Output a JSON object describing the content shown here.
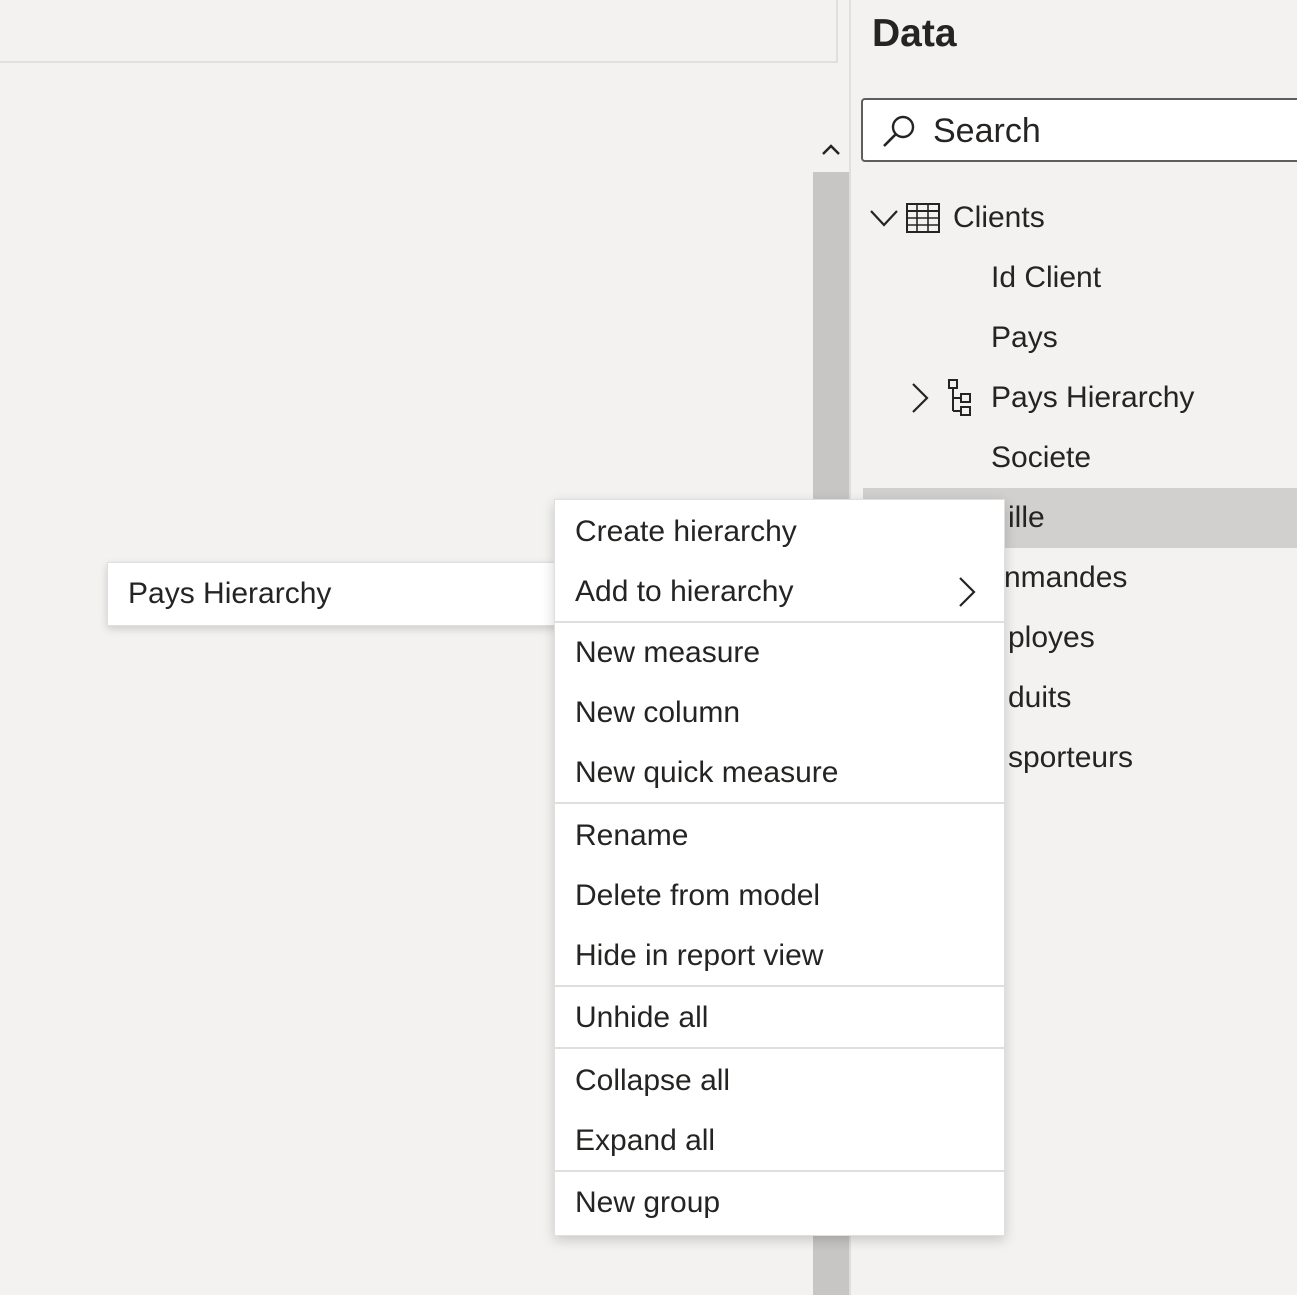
{
  "data_pane": {
    "title": "Data",
    "search_placeholder": "Search",
    "search_icon": "search-icon",
    "tree": {
      "table": {
        "label": "Clients",
        "icon": "table-icon",
        "expanded": true
      },
      "fields": [
        {
          "label": "Id Client"
        },
        {
          "label": "Pays"
        },
        {
          "label": "Pays Hierarchy",
          "icon": "hierarchy-icon",
          "expandable": true
        },
        {
          "label": "Societe"
        },
        {
          "label": "Ville",
          "visible_text": "ille",
          "selected": true
        }
      ],
      "other_tables": [
        {
          "visible_text": "nmandes"
        },
        {
          "visible_text": "ployes"
        },
        {
          "visible_text": "duits"
        },
        {
          "visible_text": "sporteurs"
        }
      ]
    }
  },
  "context_menu": {
    "items": [
      {
        "label": "Create hierarchy"
      },
      {
        "label": "Add to hierarchy",
        "has_submenu": true
      },
      {
        "label": "New measure"
      },
      {
        "label": "New column"
      },
      {
        "label": "New quick measure"
      },
      {
        "label": "Rename"
      },
      {
        "label": "Delete from model"
      },
      {
        "label": "Hide in report view"
      },
      {
        "label": "Unhide all"
      },
      {
        "label": "Collapse all"
      },
      {
        "label": "Expand all"
      },
      {
        "label": "New group"
      }
    ]
  },
  "submenu": {
    "items": [
      {
        "label": "Pays Hierarchy"
      }
    ]
  }
}
